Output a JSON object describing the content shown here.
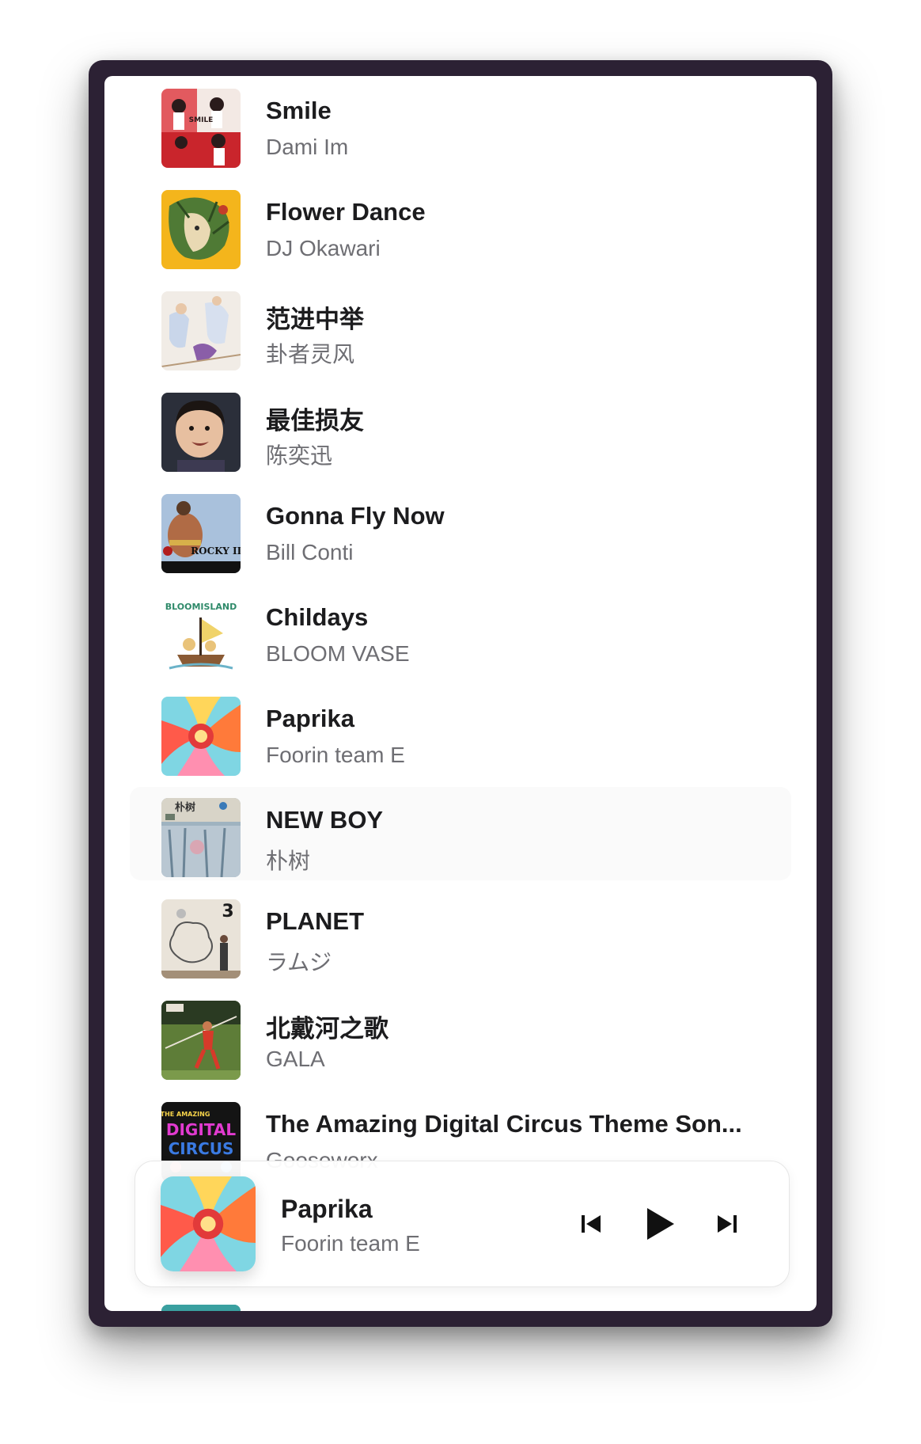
{
  "songs": [
    {
      "title": "Smile",
      "artist": "Dami Im",
      "art": "smile-cover-icon"
    },
    {
      "title": "Flower Dance",
      "artist": "DJ Okawari",
      "art": "flower-dance-cover-icon"
    },
    {
      "title": "范进中举",
      "artist": "卦者灵风",
      "art": "fanjin-cover-icon"
    },
    {
      "title": "最佳损友",
      "artist": "陈奕迅",
      "art": "child-photo-cover-icon"
    },
    {
      "title": "Gonna Fly Now",
      "artist": "Bill Conti",
      "art": "rocky-cover-icon"
    },
    {
      "title": "Childays",
      "artist": "BLOOM VASE",
      "art": "bloom-island-cover-icon"
    },
    {
      "title": "Paprika",
      "artist": "Foorin team E",
      "art": "paprika-cover-icon"
    },
    {
      "title": "NEW BOY",
      "artist": "朴树",
      "art": "new-boy-cover-icon"
    },
    {
      "title": "PLANET",
      "artist": "ラムジ",
      "art": "planet-cover-icon"
    },
    {
      "title": "北戴河之歌",
      "artist": "GALA",
      "art": "gala-cover-icon"
    },
    {
      "title": "The Amazing Digital Circus Theme Son...",
      "artist": "Gooseworx",
      "art": "digital-circus-cover-icon"
    }
  ],
  "cover_text": {
    "smile": "SMILE",
    "bloom": "BLOOMISLAND",
    "rocky": "ROCKY III",
    "new_boy": "朴树",
    "planet": "3",
    "circus_top": "THE AMAZING",
    "circus_mid": "DIGITAL",
    "circus_bot": "CIRCUS"
  },
  "now_playing": {
    "title": "Paprika",
    "artist": "Foorin team E",
    "art": "paprika-cover-icon"
  },
  "controls": {
    "previous": "previous-track-icon",
    "play": "play-icon",
    "next": "next-track-icon"
  },
  "colors": {
    "frame": "#2c2134",
    "screen": "#ffffff",
    "title_text": "#1c1c1e",
    "secondary_text": "#6e6e73"
  }
}
